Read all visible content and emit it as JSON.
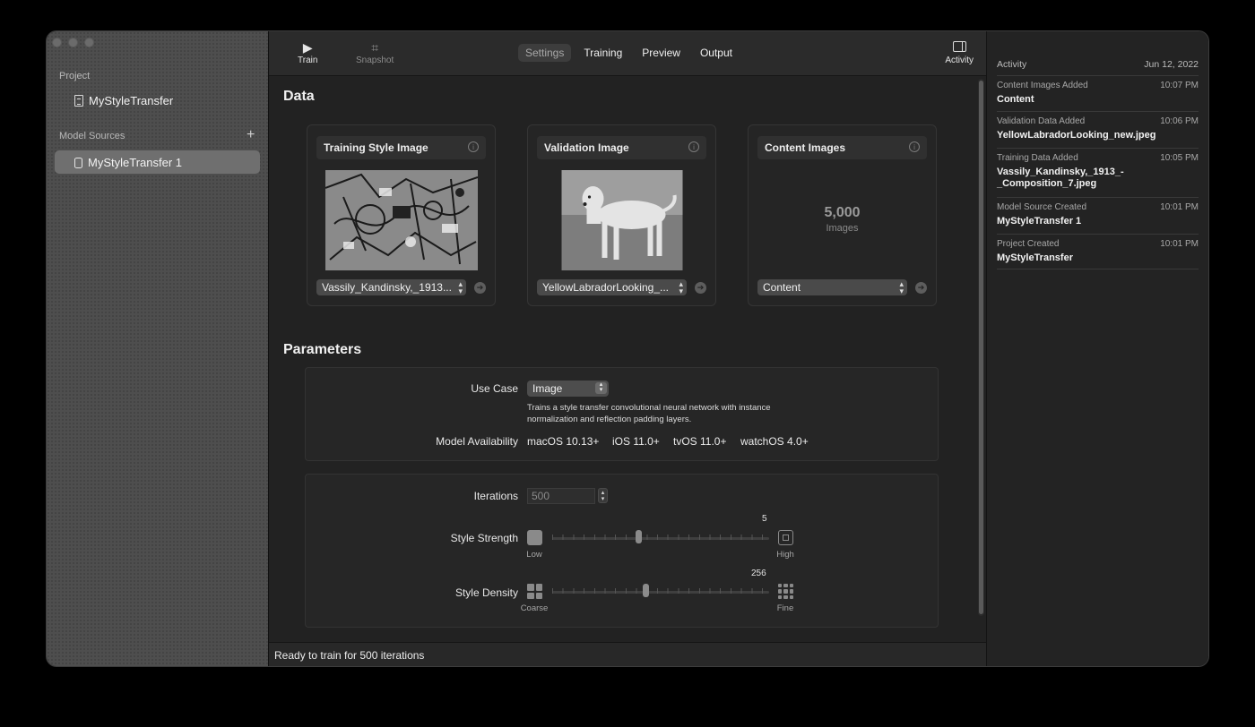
{
  "sidebar": {
    "project_header": "Project",
    "project_name": "MyStyleTransfer",
    "sources_header": "Model Sources",
    "add_symbol": "+",
    "source_item": "MyStyleTransfer 1"
  },
  "toolbar": {
    "train_label": "Train",
    "snapshot_label": "Snapshot",
    "activity_label": "Activity",
    "tabs": [
      "Settings",
      "Training",
      "Preview",
      "Output"
    ]
  },
  "data_section": {
    "title": "Data",
    "cards": [
      {
        "title": "Training Style Image",
        "selection": "Vassily_Kandinsky,_1913..."
      },
      {
        "title": "Validation Image",
        "selection": "YellowLabradorLooking_..."
      },
      {
        "title": "Content Images",
        "count": "5,000",
        "unit": "Images",
        "selection": "Content"
      }
    ]
  },
  "parameters": {
    "title": "Parameters",
    "use_case_label": "Use Case",
    "use_case_value": "Image",
    "description": "Trains a style transfer convolutional neural network with instance normalization and reflection padding layers.",
    "availability_label": "Model Availability",
    "availability": [
      "macOS 10.13+",
      "iOS 11.0+",
      "tvOS 11.0+",
      "watchOS 4.0+"
    ],
    "iterations_label": "Iterations",
    "iterations_value": "500",
    "style_strength": {
      "label": "Style Strength",
      "value": "5",
      "low": "Low",
      "high": "High",
      "level": 5,
      "min": 1,
      "max": 11
    },
    "style_density": {
      "label": "Style Density",
      "value": "256",
      "low": "Coarse",
      "high": "Fine",
      "level": 0.43
    }
  },
  "status_text": "Ready to train for 500 iterations",
  "activity": {
    "header": "Activity",
    "date": "Jun 12, 2022",
    "items": [
      {
        "title": "Content Images Added",
        "time": "10:07 PM",
        "value": "Content"
      },
      {
        "title": "Validation Data Added",
        "time": "10:06 PM",
        "value": "YellowLabradorLooking_new.jpeg"
      },
      {
        "title": "Training Data Added",
        "time": "10:05 PM",
        "value": "Vassily_Kandinsky,_1913_-_Composition_7.jpeg",
        "value_lines": [
          "Vassily_Kandinsky,_1913_-",
          "_Composition_7.jpeg"
        ]
      },
      {
        "title": "Model Source Created",
        "time": "10:01 PM",
        "value": "MyStyleTransfer 1"
      },
      {
        "title": "Project Created",
        "time": "10:01 PM",
        "value": "MyStyleTransfer"
      }
    ]
  }
}
